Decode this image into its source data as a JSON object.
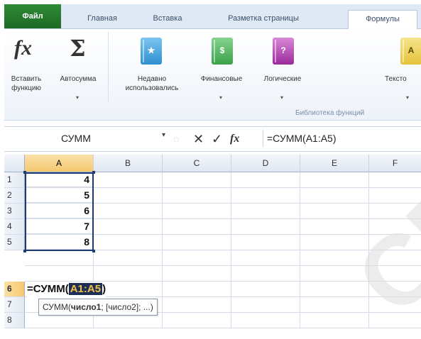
{
  "tabs": [
    {
      "label": "Файл"
    },
    {
      "label": "Главная"
    },
    {
      "label": "Вставка"
    },
    {
      "label": "Разметка страницы"
    },
    {
      "label": "Формулы"
    }
  ],
  "ribbon": {
    "insert_function": {
      "line1": "Вставить",
      "line2": "функцию"
    },
    "autosum": {
      "line1": "Автосумма"
    },
    "recent": {
      "line1": "Недавно",
      "line2": "использовались"
    },
    "financial": {
      "line1": "Финансовые"
    },
    "logical": {
      "line1": "Логические"
    },
    "text": {
      "line1": "Тексто"
    },
    "group_label": "Библиотека функций",
    "book_colors": {
      "recent": "#2f8fd0",
      "financial": "#3aa14a",
      "logical": "#9b2a9b",
      "text": "#e5c23a"
    }
  },
  "formula_bar": {
    "name_box": "СУММ",
    "cancel": "✕",
    "enter": "✓",
    "fx": "fx",
    "formula": "=СУММ(A1:A5)"
  },
  "grid": {
    "columns": [
      "A",
      "B",
      "C",
      "D",
      "E",
      "F"
    ],
    "rows": [
      "1",
      "2",
      "3",
      "4",
      "5",
      "6",
      "7",
      "8"
    ],
    "values": [
      "4",
      "5",
      "6",
      "7",
      "8"
    ],
    "edit_prefix": "=СУММ(",
    "edit_range": "A1:A5",
    "edit_suffix": ")",
    "tooltip_fn": "СУММ(",
    "tooltip_arg1": "число1",
    "tooltip_rest": "; [число2]; ...)"
  },
  "watermark": "СП"
}
